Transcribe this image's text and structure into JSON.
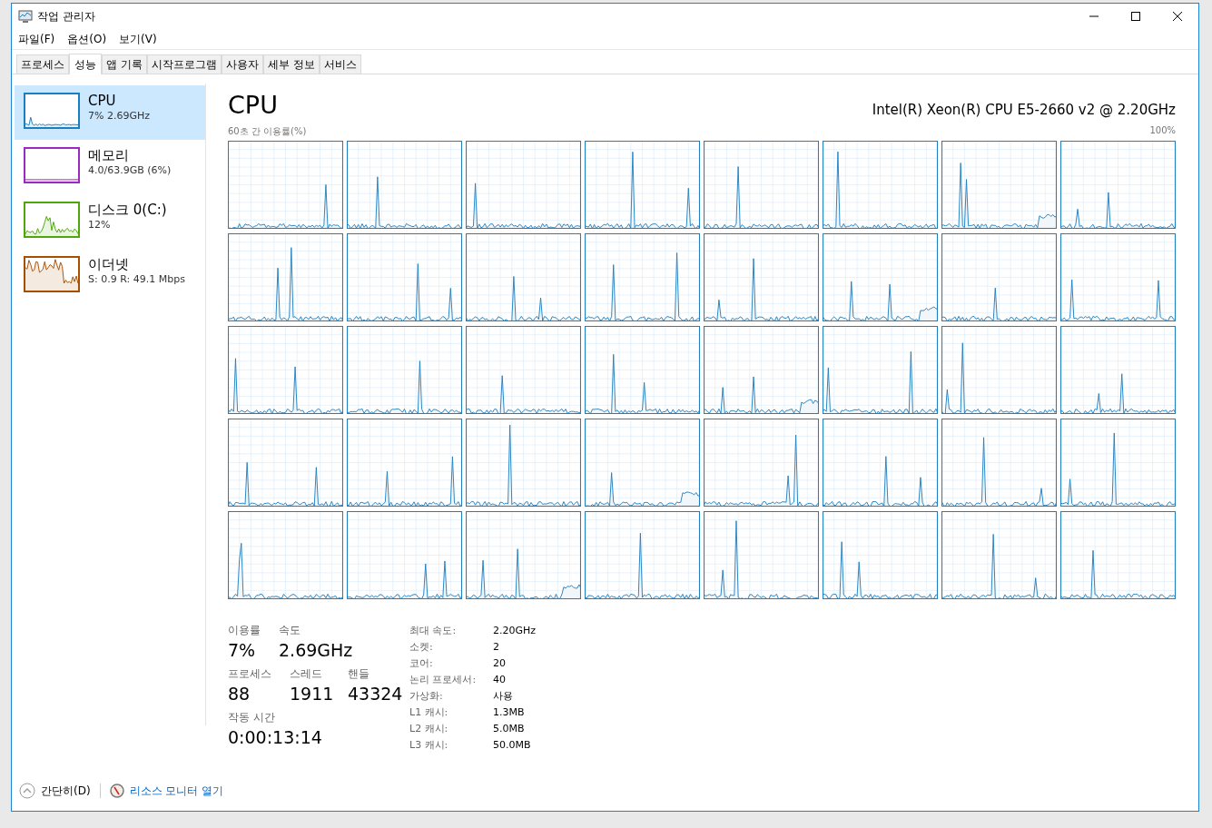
{
  "window": {
    "title": "작업 관리자"
  },
  "menu": [
    "파일(F)",
    "옵션(O)",
    "보기(V)"
  ],
  "tabs": [
    {
      "label": "프로세스",
      "selected": false
    },
    {
      "label": "성능",
      "selected": true
    },
    {
      "label": "앱 기록",
      "selected": false
    },
    {
      "label": "시작프로그램",
      "selected": false
    },
    {
      "label": "사용자",
      "selected": false
    },
    {
      "label": "세부 정보",
      "selected": false
    },
    {
      "label": "서비스",
      "selected": false
    }
  ],
  "sidebar": {
    "items": [
      {
        "kind": "cpu",
        "title": "CPU",
        "detail": "7% 2.69GHz",
        "color": "#1a7fc1",
        "selected": true
      },
      {
        "kind": "memory",
        "title": "메모리",
        "detail": "4.0/63.9GB (6%)",
        "color": "#9b2ac0",
        "selected": false
      },
      {
        "kind": "disk",
        "title": "디스크 0(C:)",
        "detail": "12%",
        "color": "#4da60c",
        "selected": false
      },
      {
        "kind": "network",
        "title": "이더넷",
        "detail": "S: 0.9 R: 49.1 Mbps",
        "color": "#a74f01",
        "selected": false
      }
    ]
  },
  "panel": {
    "title": "CPU",
    "model": "Intel(R) Xeon(R) CPU E5-2660 v2 @ 2.20GHz",
    "graph_label": "60초 간 이용률(%)",
    "graph_max": "100%"
  },
  "stats": [
    [
      {
        "label": "이용률",
        "value": "7%"
      },
      {
        "label": "속도",
        "value": "2.69GHz"
      }
    ],
    [
      {
        "label": "프로세스",
        "value": "88"
      },
      {
        "label": "스레드",
        "value": "1911"
      },
      {
        "label": "핸들",
        "value": "43324"
      }
    ],
    [
      {
        "label": "작동 시간",
        "value": "0:00:13:14"
      }
    ]
  ],
  "details": [
    {
      "label": "최대 속도:",
      "value": "2.20GHz"
    },
    {
      "label": "소켓:",
      "value": "2"
    },
    {
      "label": "코어:",
      "value": "20"
    },
    {
      "label": "논리 프로세서:",
      "value": "40"
    },
    {
      "label": "가상화:",
      "value": "사용"
    },
    {
      "label": "L1 캐시:",
      "value": "1.3MB"
    },
    {
      "label": "L2 캐시:",
      "value": "5.0MB"
    },
    {
      "label": "L3 캐시:",
      "value": "50.0MB"
    }
  ],
  "footer": {
    "collapse": "간단히(D)",
    "resource_monitor": "리소스 모니터 열기"
  }
}
